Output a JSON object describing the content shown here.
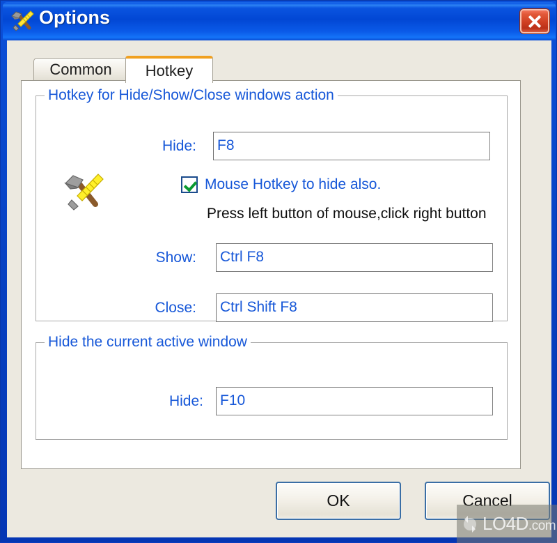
{
  "window": {
    "title": "Options",
    "icon": "hammer-and-file-icon",
    "close_button": "close-icon",
    "accent_color": "#0740c0",
    "titlebar_text_color": "#ffffff"
  },
  "tabs": [
    {
      "label": "Common",
      "active": false
    },
    {
      "label": "Hotkey",
      "active": true
    }
  ],
  "groups": {
    "hotkeys": {
      "title": "Hotkey for Hide/Show/Close windows action",
      "fields": [
        {
          "label": "Hide:",
          "value": "F8"
        },
        {
          "label": "Show:",
          "value": "Ctrl  F8"
        },
        {
          "label": "Close:",
          "value": "Ctrl  Shift  F8"
        }
      ],
      "checkbox": {
        "label": "Mouse Hotkey to hide also.",
        "checked": true
      },
      "hint": "Press left button of mouse,click right button",
      "icon": "tools-icon"
    },
    "active_window": {
      "title": "Hide the current active window",
      "fields": [
        {
          "label": "Hide:",
          "value": "F10"
        }
      ]
    }
  },
  "buttons": {
    "ok": "OK",
    "cancel": "Cancel"
  },
  "watermark": {
    "text": "LO4D",
    "suffix": ".com",
    "logo": "refresh-circle-icon"
  },
  "colors": {
    "label_blue": "#1657d8",
    "group_border": "#a8a8a8",
    "tab_active_accent": "#f0a020",
    "dialog_face": "#ece9e0"
  }
}
